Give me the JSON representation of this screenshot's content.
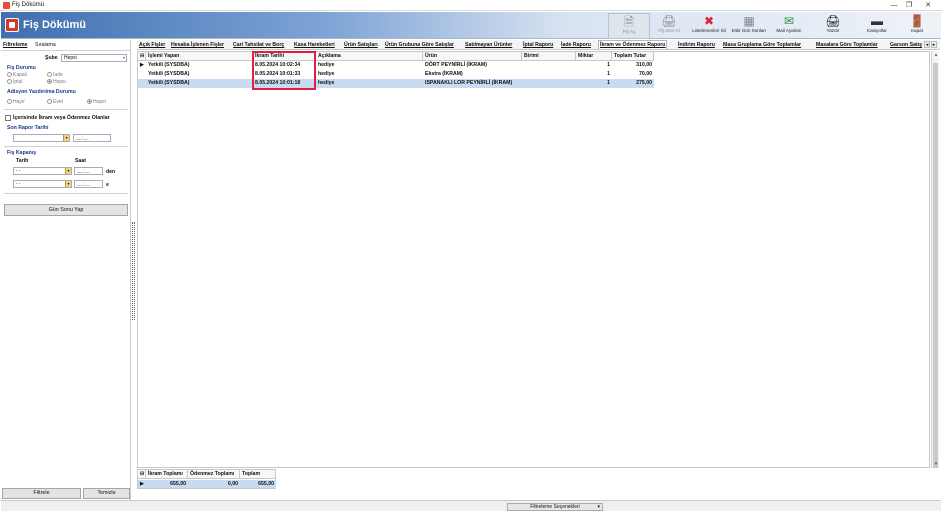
{
  "window": {
    "title": "Fiş Dökümü",
    "controls": [
      "—",
      "❐",
      "✕"
    ]
  },
  "banner": {
    "title": "Fiş Dökümü",
    "toolbar": [
      {
        "label": "Fiş Aç",
        "icon": "document-open-icon",
        "glyph": "🗎",
        "enabled": false
      },
      {
        "label": "Fiş Geri Al",
        "icon": "undo-print-icon",
        "glyph": "🖨",
        "enabled": false
      },
      {
        "label": "Listelenenleri Sil",
        "icon": "delete-icon",
        "glyph": "✖",
        "enabled": true,
        "color": "#e0202c"
      },
      {
        "label": "Eski Gün Sonları",
        "icon": "archive-icon",
        "glyph": "▦",
        "enabled": true
      },
      {
        "label": "Mail Ayarları",
        "icon": "mail-settings-icon",
        "glyph": "✉",
        "enabled": true,
        "color": "#2f8f3a"
      },
      {
        "label": "Yazdır",
        "icon": "printer-icon",
        "glyph": "🖨",
        "enabled": true
      },
      {
        "label": "Kasiyollar",
        "icon": "knife-icon",
        "glyph": "▬",
        "enabled": true
      },
      {
        "label": "Kapat",
        "icon": "exit-door-icon",
        "glyph": "🚪",
        "enabled": true,
        "color": "#b05a10"
      }
    ]
  },
  "left_panel": {
    "tabs": [
      "Filtreleme",
      "Sıralama"
    ],
    "sube_label": "Şube",
    "sube_value": "Hepsi",
    "fis_durumu_title": "Fiş Durumu",
    "fis_durumu_options": [
      "Kapalı",
      "İade",
      "İptal",
      "Hepsi"
    ],
    "fis_durumu_selected": "Hepsi",
    "adisyon_title": "Adisyon Yazdırılma Durumu",
    "adisyon_options": [
      "Hayır",
      "Evet",
      "Hepsi"
    ],
    "adisyon_selected": "Hepsi",
    "ikram_check_label": "İçerisinde İkram veya Ödenmez Olanlar",
    "son_rapor_title": "Son Rapor Tarihi",
    "time_placeholder": "__:__",
    "fis_kapanis_title": "Fiş Kapanış",
    "tarih_label": "Tarih",
    "saat_label": "Saat",
    "date_placeholder": "- -",
    "den_label": "den",
    "e_label": "e",
    "gun_sonu_button": "Gün Sonu Yap",
    "filtrele_button": "Filtrele",
    "temizle_button": "Temizle"
  },
  "tabs": [
    {
      "label": "Açık Fişler"
    },
    {
      "label": "Hesaba İşlenen Fişler"
    },
    {
      "label": "Cari Tahsilat ve Borç"
    },
    {
      "label": "Kasa Hareketleri"
    },
    {
      "label": "Ürün Satışları"
    },
    {
      "label": "Ürün Grubuna Göre Satışlar"
    },
    {
      "label": "Satılmayan Ürünler"
    },
    {
      "label": "İptal Raporu"
    },
    {
      "label": "İade Raporu"
    },
    {
      "label": "İkram ve Ödenmez Raporu",
      "active": true
    },
    {
      "label": "İndirim Raporu"
    },
    {
      "label": "Masa Gruplama Göre Toplamlar"
    },
    {
      "label": "Masalara Göre Toplamlar"
    },
    {
      "label": "Garson Satış"
    }
  ],
  "grid": {
    "columns": [
      "İşlemi Yapan",
      "İkram Tarihi",
      "Açıklama",
      "Ürün",
      "Birimi",
      "Miktar",
      "Toplam Tutar"
    ],
    "rows": [
      {
        "islemi_yapan": "Yetkili (SYSDBA)",
        "tarih": "8.05.2024 10:02:34",
        "aciklama": "hediye",
        "urun": "DÖRT PEYNİRLİ (İKRAM)",
        "birimi": "",
        "miktar": "1",
        "tutar": "310,00"
      },
      {
        "islemi_yapan": "Yetkili (SYSDBA)",
        "tarih": "8.05.2024 10:01:33",
        "aciklama": "hediye",
        "urun": "Ekstra (İKRAM)",
        "birimi": "",
        "miktar": "1",
        "tutar": "70,00"
      },
      {
        "islemi_yapan": "Yetkili (SYSDBA)",
        "tarih": "8.05.2024 10:01:18",
        "aciklama": "hediye",
        "urun": "ISPANAKLI LOR PEYNİRLİ (İKRAM)",
        "birimi": "",
        "miktar": "1",
        "tutar": "275,00"
      }
    ]
  },
  "summary": {
    "columns": [
      "İkram Toplamı",
      "Ödenmez Toplamı",
      "Toplam"
    ],
    "values": [
      "655,00",
      "0,00",
      "655,00"
    ]
  },
  "statusbar": {
    "filter_options": "Filtreleme Seçenekleri"
  },
  "colors": {
    "highlight_box": "#e02040",
    "selected_row": "#c7dcf3",
    "banner_blue": "#3f6fb0",
    "section_title": "#1b3a8c"
  }
}
